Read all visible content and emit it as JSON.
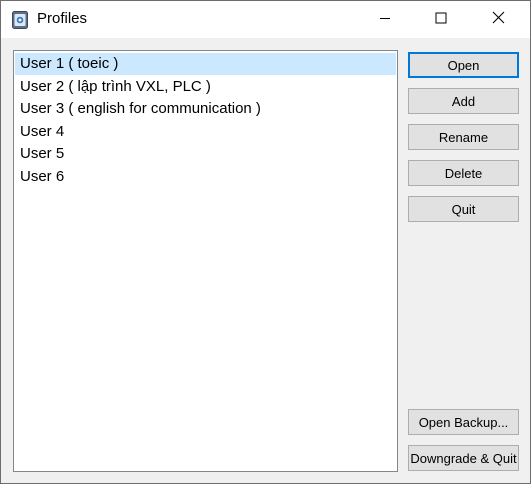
{
  "window": {
    "title": "Profiles",
    "app_icon": "profile-manager-icon",
    "accent": "#0078d7"
  },
  "titlebar": {
    "minimize_icon": "minimize-icon",
    "maximize_icon": "maximize-icon",
    "close_icon": "close-icon"
  },
  "profiles": {
    "selected_index": 0,
    "selection_color": "#cce8ff",
    "items": [
      {
        "label": "User 1 ( toeic )"
      },
      {
        "label": "User 2 ( lập trình VXL, PLC )"
      },
      {
        "label": "User 3 ( english for communication )"
      },
      {
        "label": "User 4"
      },
      {
        "label": "User 5"
      },
      {
        "label": "User 6"
      }
    ]
  },
  "buttons": {
    "open": "Open",
    "add": "Add",
    "rename": "Rename",
    "delete": "Delete",
    "quit": "Quit",
    "open_backup": "Open Backup...",
    "downgrade_quit": "Downgrade & Quit"
  }
}
